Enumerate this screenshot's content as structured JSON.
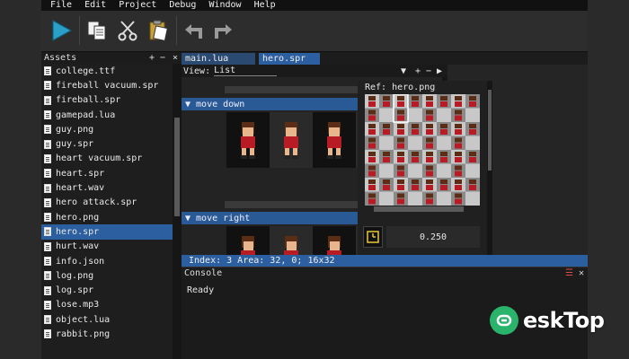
{
  "menu": [
    "File",
    "Edit",
    "Project",
    "Debug",
    "Window",
    "Help"
  ],
  "toolbar": {
    "buttons": [
      "play-icon",
      "copy-icon",
      "cut-icon",
      "paste-icon",
      "undo-icon",
      "redo-icon"
    ]
  },
  "assets": {
    "title": "Assets",
    "actions": [
      "+",
      "−",
      "×"
    ],
    "items": [
      "college.ttf",
      "fireball vacuum.spr",
      "fireball.spr",
      "gamepad.lua",
      "guy.png",
      "guy.spr",
      "heart vacuum.spr",
      "heart.spr",
      "heart.wav",
      "hero attack.spr",
      "hero.png",
      "hero.spr",
      "hurt.wav",
      "info.json",
      "log.png",
      "log.spr",
      "lose.mp3",
      "object.lua",
      "rabbit.png"
    ],
    "selected": "hero.spr"
  },
  "tabs": [
    "main.lua",
    "hero.spr"
  ],
  "active_tab": "hero.spr",
  "view": {
    "label": "View:",
    "value": "List",
    "actions": [
      "+",
      "−",
      "▶"
    ]
  },
  "sequences": [
    {
      "name": "move down",
      "frame_count": 4
    },
    {
      "name": "move right",
      "frame_count": 4
    }
  ],
  "ref": {
    "title": "Ref: hero.png",
    "value": "0.250"
  },
  "status": {
    "text": "Index: 3  Area: 32, 0; 16x32"
  },
  "console": {
    "title": "Console",
    "output": "Ready"
  },
  "watermark": {
    "text": "eskTop"
  },
  "colors": {
    "accent": "#2c5fa0",
    "background": "#252526",
    "menubar": "#111111"
  }
}
